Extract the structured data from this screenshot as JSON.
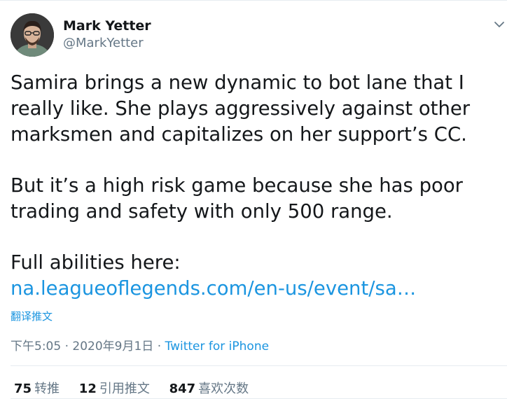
{
  "author": {
    "name": "Mark Yetter",
    "handle": "@MarkYetter",
    "avatar_icon": "profile-photo"
  },
  "menu_icon": "chevron-down-icon",
  "tweet": {
    "paragraphs": [
      "Samira brings a new dynamic to bot lane that I really like. She plays aggressively against other marksmen and capitalizes on her support’s CC.",
      "But it’s a high risk game because she has poor trading and safety with only 500 range.",
      "Full abilities here:"
    ],
    "link": "na.leagueoflegends.com/en-us/event/sa…"
  },
  "translate_label": "翻译推文",
  "meta": {
    "timestamp": "下午5:05 · 2020年9月1日",
    "separator": " · ",
    "source": "Twitter for iPhone"
  },
  "stats": [
    {
      "count": "75",
      "label": "转推"
    },
    {
      "count": "12",
      "label": "引用推文"
    },
    {
      "count": "847",
      "label": "喜欢次数"
    }
  ],
  "colors": {
    "text": "#14171a",
    "secondary": "#657786",
    "link": "#1b95e0",
    "divider": "#e6ecf0"
  }
}
